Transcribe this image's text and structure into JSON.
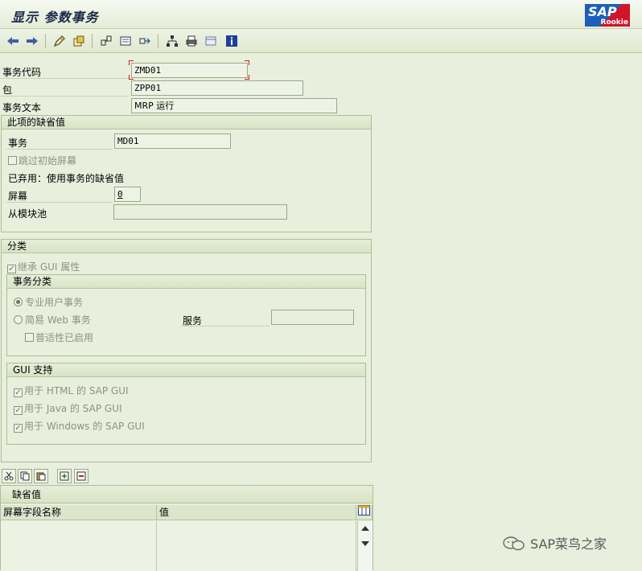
{
  "window": {
    "title": "显示 参数事务"
  },
  "logo": {
    "main": "SAP",
    "sub": "Rookie"
  },
  "toolbar": {
    "icons": [
      "back-arrow-icon",
      "forward-arrow-icon",
      "display-change-icon",
      "other-object-icon",
      "where-used-icon",
      "object-list-icon",
      "navigation-icon",
      "hierarchy-icon",
      "print-icon",
      "layout-icon",
      "info-icon"
    ]
  },
  "header": {
    "tcode_label": "事务代码",
    "tcode_value": "ZMD01",
    "package_label": "包",
    "package_value": "ZPP01",
    "text_label": "事务文本",
    "text_value": "MRP 运行"
  },
  "defaults_group": {
    "title": "此项的缺省值",
    "transaction_label": "事务",
    "transaction_value": "MD01",
    "skip_screen_label": "跳过初始屏幕",
    "obsolete_label": "已弃用：使用事务的缺省值",
    "screen_label": "屏幕",
    "screen_value": "0",
    "module_pool_label": "从模块池",
    "module_pool_value": ""
  },
  "classification_group": {
    "title": "分类",
    "inherit_gui_label": "继承 GUI 属性",
    "tx_class_title": "事务分类",
    "professional_label": "专业用户事务",
    "easy_web_label": "简易 Web 事务",
    "service_label": "服务",
    "service_value": "",
    "pervasive_label": "普适性已启用",
    "gui_support_title": "GUI 支持",
    "html_gui_label": "用于 HTML 的 SAP GUI",
    "java_gui_label": "用于 Java 的 SAP GUI",
    "windows_gui_label": "用于 Windows 的 SAP GUI"
  },
  "default_values_table": {
    "title": "缺省值",
    "col_name": "屏幕字段名称",
    "col_value": "值"
  },
  "watermark": {
    "text": "SAP菜鸟之家"
  }
}
